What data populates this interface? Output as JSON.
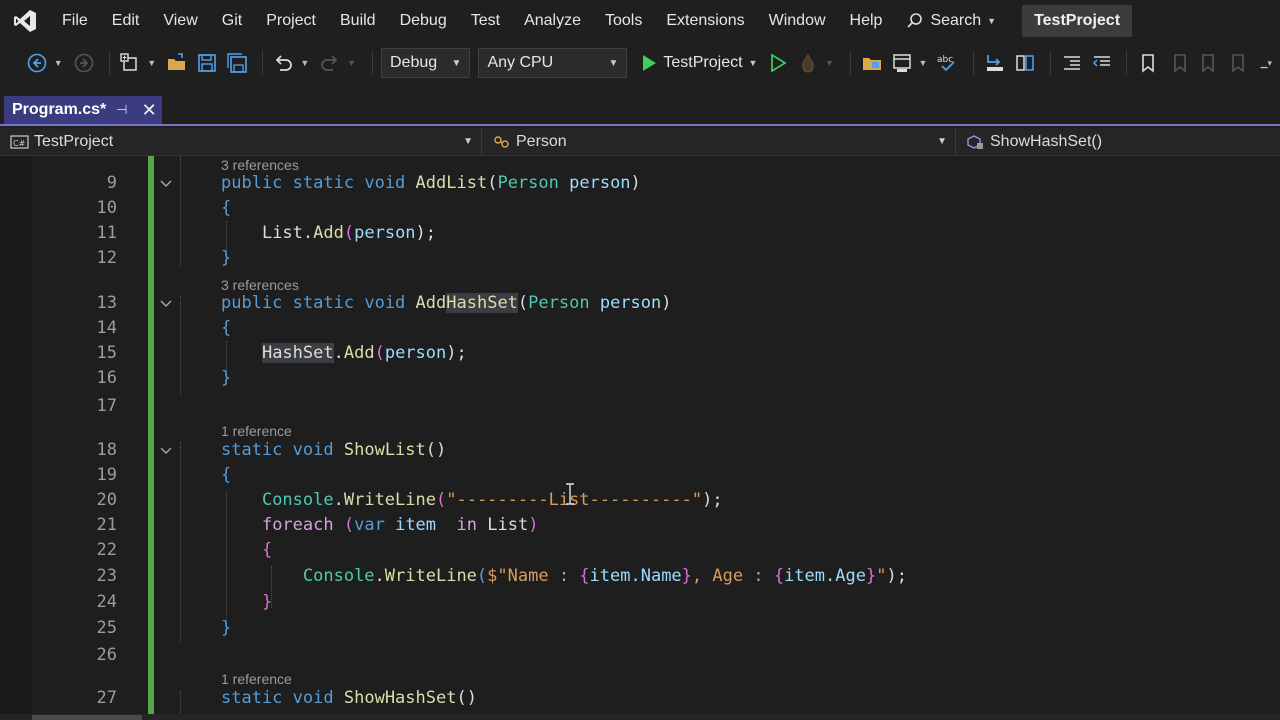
{
  "menu": {
    "items": [
      "File",
      "Edit",
      "View",
      "Git",
      "Project",
      "Build",
      "Debug",
      "Test",
      "Analyze",
      "Tools",
      "Extensions",
      "Window",
      "Help"
    ],
    "search_label": "Search",
    "project_badge": "TestProject"
  },
  "toolbar": {
    "configuration": "Debug",
    "platform": "Any CPU",
    "run_target": "TestProject"
  },
  "tab": {
    "title": "Program.cs*"
  },
  "navbar": {
    "project": "TestProject",
    "type": "Person",
    "member": "ShowHashSet()"
  },
  "editor": {
    "lenses": [
      "3 references",
      "3 references",
      "1 reference",
      "1 reference"
    ],
    "line_numbers": [
      "9",
      "10",
      "11",
      "12",
      "13",
      "14",
      "15",
      "16",
      "17",
      "18",
      "19",
      "20",
      "21",
      "22",
      "23",
      "24",
      "25",
      "26",
      "27"
    ],
    "code": {
      "l9": {
        "kw1": "public",
        "kw2": "static",
        "kw3": "void",
        "name": "AddList",
        "p1": "(",
        "type": "Person",
        "param": "person",
        "p2": ")"
      },
      "l10": "{",
      "l11": {
        "obj": "List",
        "dot": ".",
        "m": "Add",
        "p1": "(",
        "arg": "person",
        "p2": ");"
      },
      "l12": "}",
      "l13": {
        "kw1": "public",
        "kw2": "static",
        "kw3": "void",
        "name1": "Add",
        "name2": "HashSet",
        "p1": "(",
        "type": "Person",
        "param": "person",
        "p2": ")"
      },
      "l14": "{",
      "l15": {
        "obj": "HashSet",
        "dot": ".",
        "m": "Add",
        "p1": "(",
        "arg": "person",
        "p2": ");"
      },
      "l16": "}",
      "l18": {
        "kw1": "static",
        "kw2": "void",
        "name": "ShowList",
        "p": "()"
      },
      "l19": "{",
      "l20": {
        "obj": "Console",
        "dot": ".",
        "m": "WriteLine",
        "p1": "(",
        "str": "\"---------List----------\"",
        "p2": ");"
      },
      "l21": {
        "kw": "foreach",
        "p1": "(",
        "kw2": "var",
        "var": "item",
        "kw3": "in",
        "coll": "List",
        "p2": ")"
      },
      "l22": "{",
      "l23": {
        "obj": "Console",
        "dot": ".",
        "m": "WriteLine",
        "p1": "(",
        "s1": "$\"Name : ",
        "b1": "{",
        "e1": "item.Name",
        "b2": "}",
        "s2": ", Age : ",
        "b3": "{",
        "e2": "item.Age",
        "b4": "}",
        "s3": "\"",
        "p2": ");"
      },
      "l24": "}",
      "l25": "}",
      "l27": {
        "kw1": "static",
        "kw2": "void",
        "name": "ShowHashSet",
        "p": "()"
      }
    }
  },
  "colors": {
    "accent": "#7a72c8",
    "change_bar": "#57a64a",
    "tab_active": "#3b3b80"
  }
}
